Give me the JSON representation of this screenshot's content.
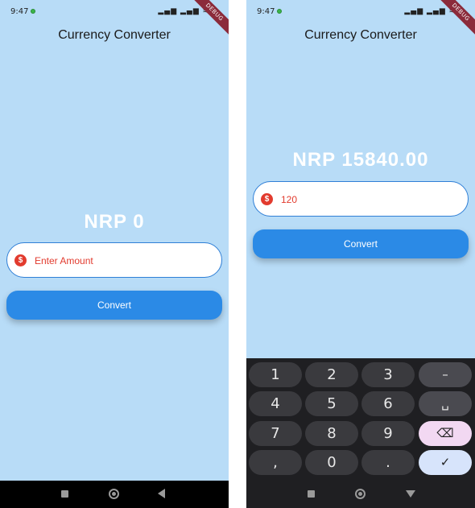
{
  "status": {
    "time": "9:47",
    "icons": "▂▄▆ ▂▄▆ ≋ ▮",
    "debug": "DEBUG"
  },
  "app": {
    "title": "Currency Converter",
    "convert_label": "Convert"
  },
  "left_screen": {
    "result": "NRP  0",
    "input_placeholder": "Enter Amount",
    "input_value": ""
  },
  "right_screen": {
    "result": "NRP  15840.00",
    "input_value": "120"
  },
  "icons": {
    "dollar": "$",
    "input_icon": "dollar-circle-icon"
  },
  "keyboard": {
    "keys": [
      "1",
      "2",
      "3",
      "–",
      "4",
      "5",
      "6",
      "␣",
      "7",
      "8",
      "9",
      "⌫",
      ",",
      "0",
      ".",
      "✓"
    ]
  },
  "colors": {
    "background": "#b8dcf7",
    "accent": "#2b8ae6",
    "error_text": "#e23b2e"
  }
}
